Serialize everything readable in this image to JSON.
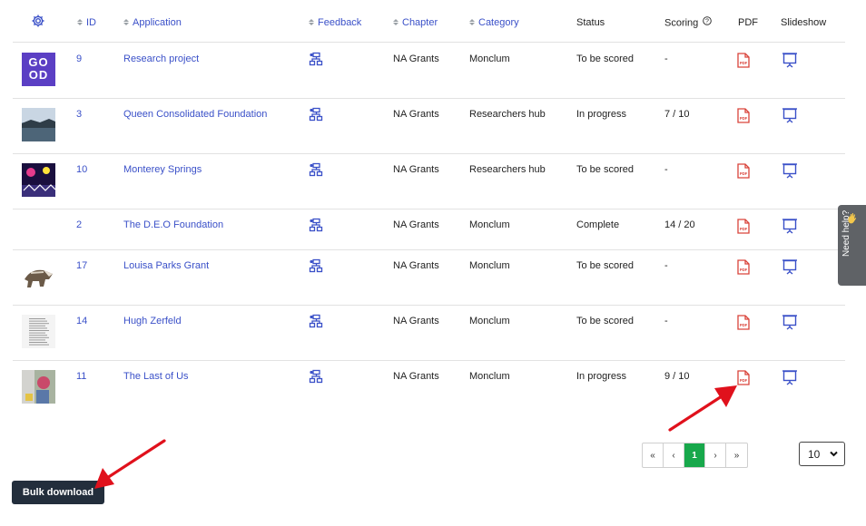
{
  "headers": {
    "id": "ID",
    "application": "Application",
    "feedback": "Feedback",
    "chapter": "Chapter",
    "category": "Category",
    "status": "Status",
    "scoring": "Scoring",
    "pdf": "PDF",
    "slideshow": "Slideshow"
  },
  "rows": [
    {
      "id": "9",
      "application": "Research project",
      "chapter": "NA Grants",
      "category": "Monclum",
      "status": "To be scored",
      "scoring": "-",
      "thumb": "good-logo",
      "thumb_text": [
        "GO",
        "OD"
      ]
    },
    {
      "id": "3",
      "application": "Queen Consolidated Foundation",
      "chapter": "NA Grants",
      "category": "Researchers hub",
      "status": "In progress",
      "scoring": "7 / 10",
      "thumb": "lake-photo"
    },
    {
      "id": "10",
      "application": "Monterey Springs",
      "chapter": "NA Grants",
      "category": "Researchers hub",
      "status": "To be scored",
      "scoring": "-",
      "thumb": "concert-photo"
    },
    {
      "id": "2",
      "application": "The D.E.O Foundation",
      "chapter": "NA Grants",
      "category": "Monclum",
      "status": "Complete",
      "scoring": "14 / 20",
      "thumb": "none"
    },
    {
      "id": "17",
      "application": "Louisa Parks Grant",
      "chapter": "NA Grants",
      "category": "Monclum",
      "status": "To be scored",
      "scoring": "-",
      "thumb": "badger-image"
    },
    {
      "id": "14",
      "application": "Hugh Zerfeld",
      "chapter": "NA Grants",
      "category": "Monclum",
      "status": "To be scored",
      "scoring": "-",
      "thumb": "document-page"
    },
    {
      "id": "11",
      "application": "The Last of Us",
      "chapter": "NA Grants",
      "category": "Monclum",
      "status": "In progress",
      "scoring": "9 / 10",
      "thumb": "street-art-photo"
    }
  ],
  "pagination": {
    "first": "«",
    "prev": "‹",
    "current": "1",
    "next": "›",
    "last": "»"
  },
  "page_size": "10",
  "bulk_download": "Bulk download",
  "need_help": "Need help?",
  "icons": {
    "settings": "gear-icon",
    "feedback": "feedback-tree-icon",
    "pdf": "pdf-file-icon",
    "slideshow": "presentation-icon",
    "help": "help-circle-icon"
  },
  "colors": {
    "link": "#3a50c8",
    "pdf": "#d9433a",
    "active_page": "#17a84b",
    "button": "#232e3c",
    "annotation_arrow": "#e0111c"
  }
}
